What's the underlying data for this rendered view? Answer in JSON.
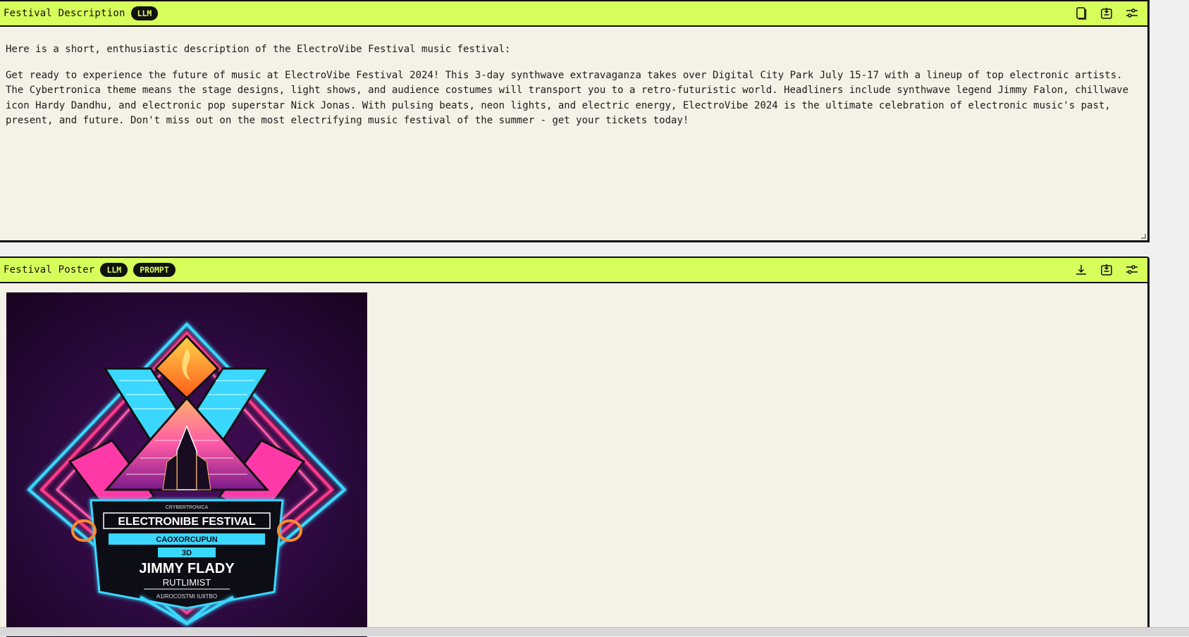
{
  "description_panel": {
    "title": "Festival Description",
    "badges": [
      "LLM"
    ],
    "icons": [
      "copy-icon",
      "export-icon",
      "settings-sliders-icon"
    ],
    "intro": "Here is a short, enthusiastic description of the ElectroVibe Festival music festival:",
    "body": "Get ready to experience the future of music at ElectroVibe Festival 2024! This 3-day synthwave extravaganza takes over Digital City Park July 15-17 with a lineup of top electronic artists. The Cybertronica theme means the stage designs, light shows, and audience costumes will transport you to a retro-futuristic world. Headliners include synthwave legend Jimmy Falon, chillwave icon Hardy Dandhu, and electronic pop superstar Nick Jonas. With pulsing beats, neon lights, and electric energy, ElectroVibe 2024 is the ultimate celebration of electronic music's past, present, and future. Don't miss out on the most electrifying music festival of the summer - get your tickets today!"
  },
  "poster_panel": {
    "title": "Festival Poster",
    "badges": [
      "LLM",
      "PROMPT"
    ],
    "icons": [
      "download-icon",
      "export-icon",
      "settings-sliders-icon"
    ],
    "poster_text": {
      "top_small": "CRYBERTRONICA",
      "headline": "ELECTRONIBE FESTIVAL",
      "line2": "CAOXORCUPUN",
      "line3": "3D",
      "line4": "JIMMY FLADY",
      "line5": "RUTLIMIST",
      "line6": "A1IROCOSTMI IUIITBO"
    }
  },
  "colors": {
    "header_bg": "#d7ff5c",
    "panel_bg": "#f4f1e6",
    "badge_bg": "#111111",
    "badge_text": "#d7ff5c"
  }
}
